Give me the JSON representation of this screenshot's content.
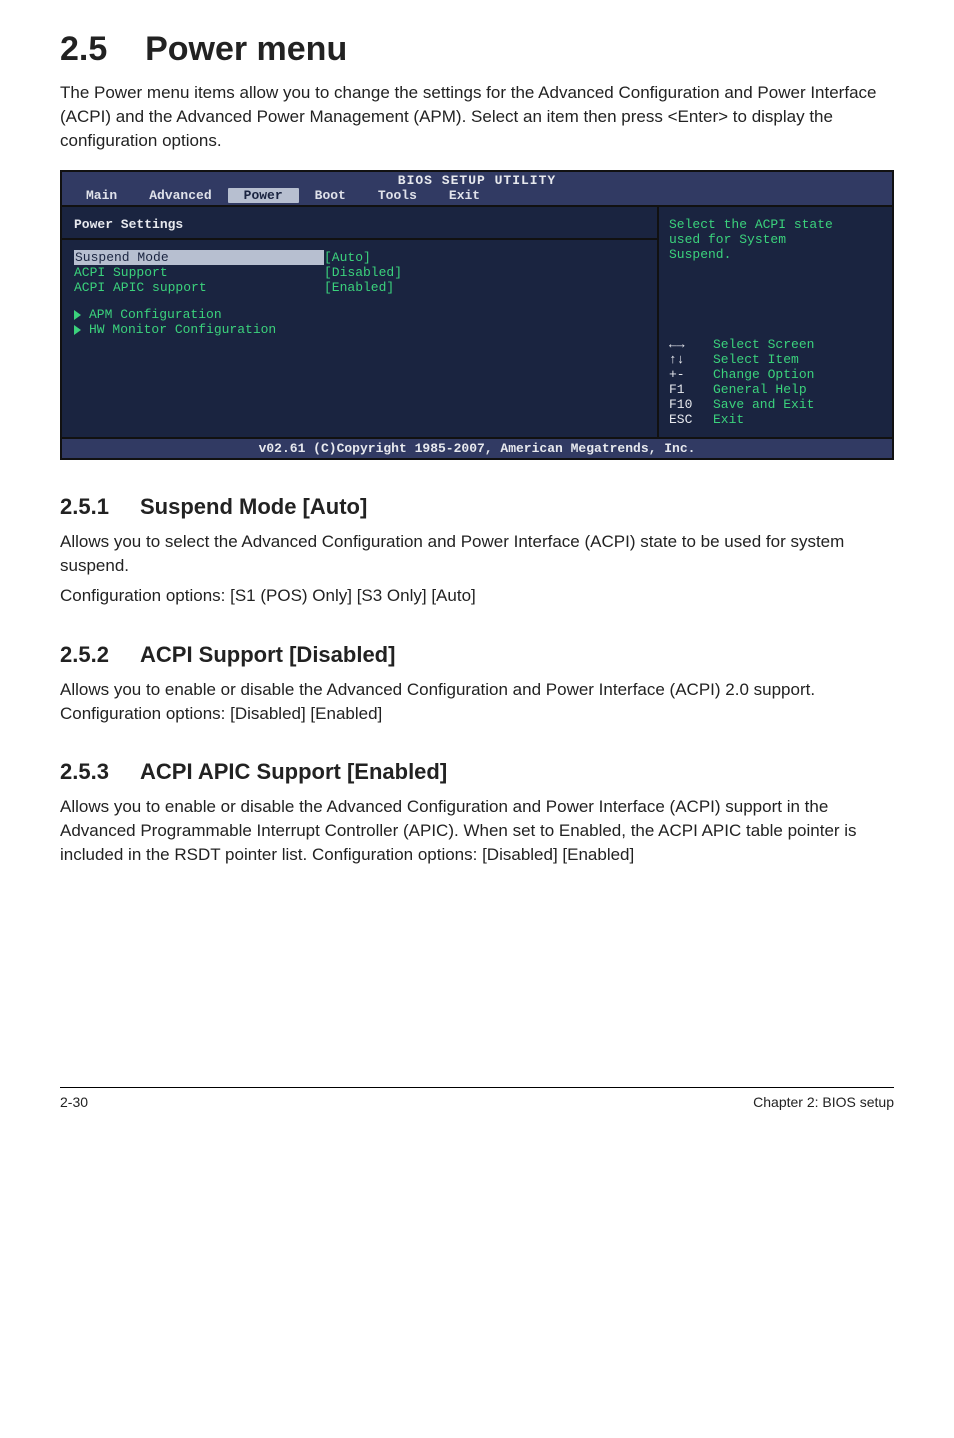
{
  "section": {
    "number": "2.5",
    "title": "Power menu"
  },
  "intro": "The Power menu items allow you to change the settings for the Advanced Configuration and Power Interface (ACPI) and the Advanced Power Management (APM). Select an item then press <Enter> to display the configuration options.",
  "bios": {
    "header": "BIOS SETUP UTILITY",
    "menus": [
      "Main",
      "Advanced",
      "Power",
      "Boot",
      "Tools",
      "Exit"
    ],
    "active_menu_index": 2,
    "left": {
      "panel_title": "Power Settings",
      "settings": [
        {
          "label": "Suspend Mode",
          "value": "[Auto]",
          "selected": true
        },
        {
          "label": "ACPI Support",
          "value": "[Disabled]",
          "selected": false
        },
        {
          "label": "ACPI APIC support",
          "value": "[Enabled]",
          "selected": false
        }
      ],
      "subitems": [
        "APM Configuration",
        "HW Monitor Configuration"
      ]
    },
    "right": {
      "help_lines": [
        "Select the ACPI state",
        "used for System",
        "Suspend."
      ],
      "nav": [
        {
          "key": "←→",
          "desc": "Select Screen"
        },
        {
          "key": "↑↓",
          "desc": "Select Item"
        },
        {
          "key": "+-",
          "desc": "Change Option"
        },
        {
          "key": "F1",
          "desc": "General Help"
        },
        {
          "key": "F10",
          "desc": "Save and Exit"
        },
        {
          "key": "ESC",
          "desc": "Exit"
        }
      ]
    },
    "footer": "v02.61 (C)Copyright 1985-2007, American Megatrends, Inc."
  },
  "subs": {
    "s1": {
      "num": "2.5.1",
      "title": "Suspend Mode [Auto]",
      "p1": "Allows you to select the Advanced Configuration and Power Interface (ACPI) state to be used for system suspend.",
      "p2": "Configuration options: [S1 (POS) Only] [S3 Only] [Auto]"
    },
    "s2": {
      "num": "2.5.2",
      "title": "ACPI Support [Disabled]",
      "p1": "Allows you to enable or disable the Advanced Configuration and Power Interface (ACPI) 2.0 support. Configuration options: [Disabled] [Enabled]"
    },
    "s3": {
      "num": "2.5.3",
      "title": "ACPI APIC Support [Enabled]",
      "p1": "Allows you to enable or disable the Advanced Configuration and Power Interface (ACPI) support in the Advanced Programmable Interrupt Controller (APIC). When set to Enabled, the ACPI APIC table pointer is included in the RSDT pointer list. Configuration options: [Disabled] [Enabled]"
    }
  },
  "footer": {
    "left": "2-30",
    "right": "Chapter 2: BIOS setup"
  }
}
